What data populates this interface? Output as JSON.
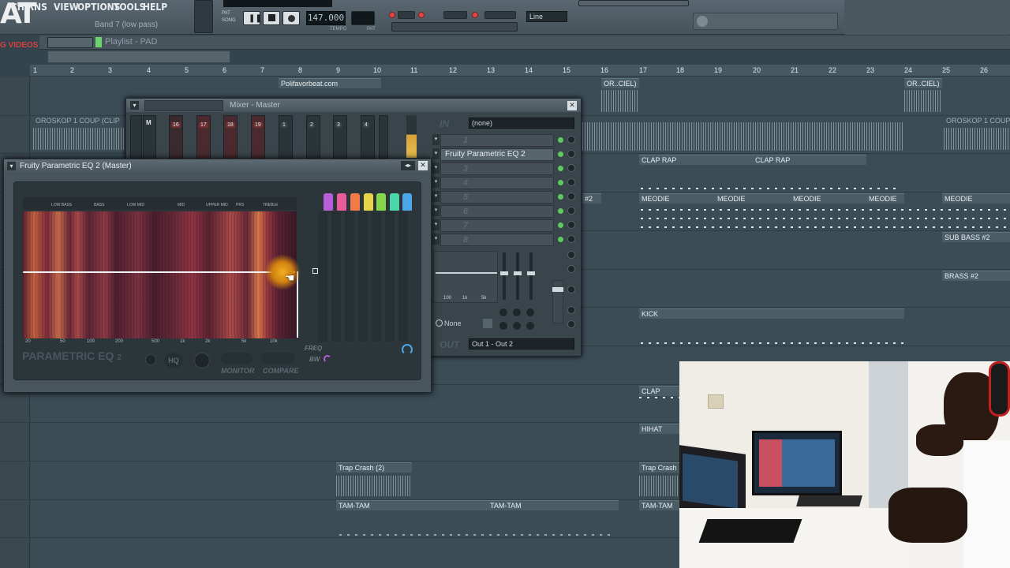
{
  "menu": {
    "items": [
      {
        "label": "VIEW"
      },
      {
        "label": "OPTIONS"
      },
      {
        "label": "TOOLS"
      },
      {
        "label": "HELP"
      }
    ],
    "partial": "CH  RNS"
  },
  "hint_bar": {
    "text": "Band 7 (low pass)"
  },
  "transport": {
    "tempo": "147.000",
    "tempo_label": "TEMPO",
    "pat_label": "PAT",
    "song_label": "SONG",
    "snap_select": "Line"
  },
  "logo": {
    "text": "AT",
    "sub": "G VIDEOS"
  },
  "playlist": {
    "title": "Playlist - PAD",
    "ruler": [
      "1",
      "2",
      "3",
      "4",
      "5",
      "6",
      "7",
      "8",
      "9",
      "10",
      "11",
      "12",
      "13",
      "14",
      "15",
      "16",
      "17",
      "18",
      "19",
      "20",
      "21",
      "22",
      "23",
      "24",
      "25",
      "26"
    ],
    "clips": [
      {
        "label": "Polifavorbeat.com"
      },
      {
        "label": "OR..CIEL)"
      },
      {
        "label": "OR..CIEL)"
      },
      {
        "label": "OROSKOP  1 COUP (CLIP"
      },
      {
        "label": "OROSKOP  1 COUP (CLIP"
      },
      {
        "label": "CLAP RAP"
      },
      {
        "label": "CLAP RAP"
      },
      {
        "label": "MEODIE"
      },
      {
        "label": "MEODIE"
      },
      {
        "label": "MEODIE"
      },
      {
        "label": "MEODIE"
      },
      {
        "label": "MEODIE"
      },
      {
        "label": "#2"
      },
      {
        "label": "SUB BASS #2"
      },
      {
        "label": "BRASS #2"
      },
      {
        "label": "KICK"
      },
      {
        "label": "CLAP"
      },
      {
        "label": "HIHAT"
      },
      {
        "label": "Trap Crash (2)"
      },
      {
        "label": "Trap Crash"
      },
      {
        "label": "TAM-TAM"
      },
      {
        "label": "TAM-TAM"
      },
      {
        "label": "TAM-TAM"
      }
    ]
  },
  "mixer": {
    "title": "Mixer - Master",
    "inserts": [
      "16",
      "17",
      "18",
      "19",
      "1",
      "2",
      "3",
      "4"
    ],
    "master_label": "M",
    "in_label": "IN",
    "in_value": "(none)",
    "slots": [
      "1",
      "Fruity Parametric EQ 2",
      "3",
      "4",
      "5",
      "6",
      "7",
      "8"
    ],
    "none_label": "None",
    "out_label": "OUT",
    "out_value": "Out 1 - Out 2",
    "eq_ticks": [
      "100",
      "1k",
      "5k"
    ]
  },
  "eq": {
    "title": "Fruity Parametric EQ 2 (Master)",
    "brand": "PARAMETRIC EQ",
    "brand_num": "2",
    "monitor_label": "MONITOR",
    "compare_label": "COMPARE",
    "hq_label": "HQ",
    "freq_label": "FREQ",
    "bw_label": "BW",
    "band_labels": [
      "LOW BASS",
      "BASS",
      "LOW MID",
      "MID",
      "UPPER MID",
      "PRS",
      "TREBLE"
    ],
    "freq_ticks": [
      "20",
      "50",
      "100",
      "200",
      "500",
      "1k",
      "2k",
      "5k",
      "10k"
    ],
    "band_colors": [
      "#b55ed8",
      "#e85c9c",
      "#f07a48",
      "#e8d24a",
      "#86d64c",
      "#4ad8a8",
      "#4ca6e8"
    ]
  }
}
